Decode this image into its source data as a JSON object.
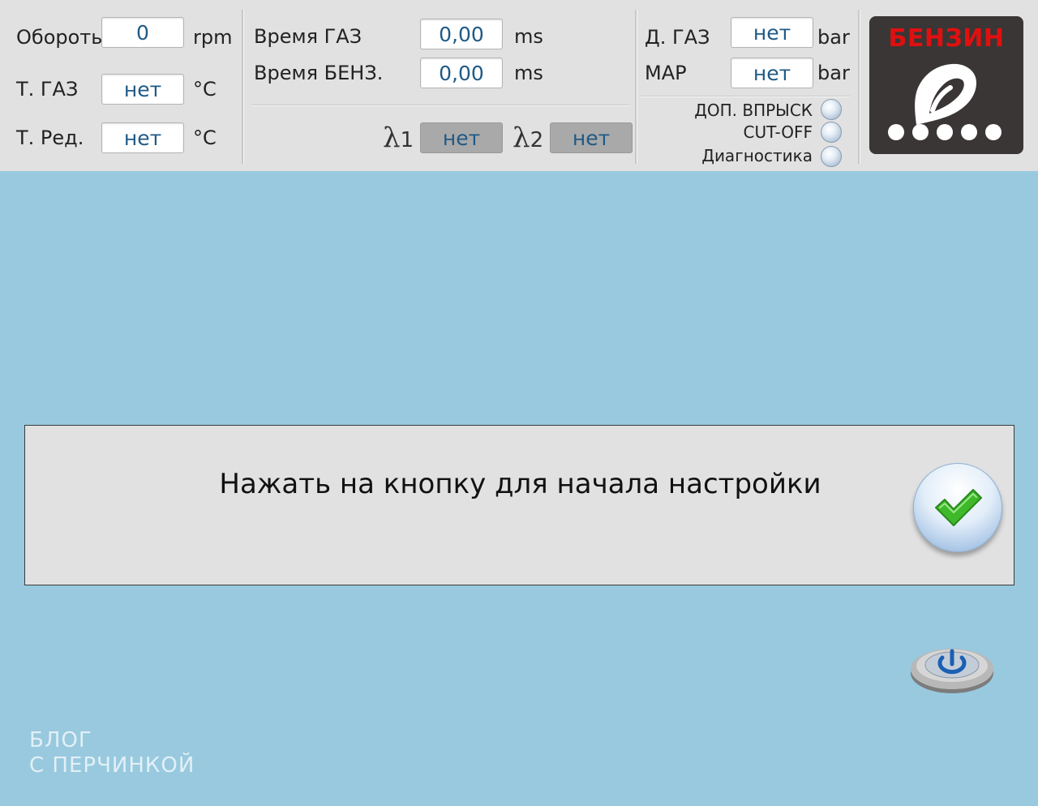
{
  "gauges": {
    "rpm": {
      "label": "Обороты",
      "value": "0",
      "unit": "rpm"
    },
    "gas_temp": {
      "label": "Т. ГАЗ",
      "value": "нет",
      "unit": "°C"
    },
    "reducer_temp": {
      "label": "Т. Ред.",
      "value": "нет",
      "unit": "°C"
    },
    "gas_time": {
      "label": "Время ГАЗ",
      "value": "0,00",
      "unit": "ms"
    },
    "petrol_time": {
      "label": "Время БЕНЗ.",
      "value": "0,00",
      "unit": "ms"
    },
    "lambda1": {
      "label": "1",
      "value": "нет"
    },
    "lambda2": {
      "label": "2",
      "value": "нет"
    },
    "gas_pressure": {
      "label": "Д. ГАЗ",
      "value": "нет",
      "unit": "bar"
    },
    "map": {
      "label": "MAP",
      "value": "нет",
      "unit": "bar"
    }
  },
  "indicators": [
    {
      "label": "ДОП. ВПРЫСК"
    },
    {
      "label": "CUT-OFF"
    },
    {
      "label": "Диагностика"
    }
  ],
  "fuel_mode": {
    "label": "БЕНЗИН",
    "level_dots": 5
  },
  "message": {
    "text": "Нажать на кнопку для начала настройки"
  },
  "watermark": {
    "line1": "БЛОГ",
    "line2": "С ПЕРЧИНКОЙ"
  },
  "colors": {
    "background": "#98c9df",
    "panel": "#e1e1e1",
    "value_text": "#1f5a86",
    "fuel_label": "#e01010",
    "fuel_panel": "#3a3635"
  }
}
